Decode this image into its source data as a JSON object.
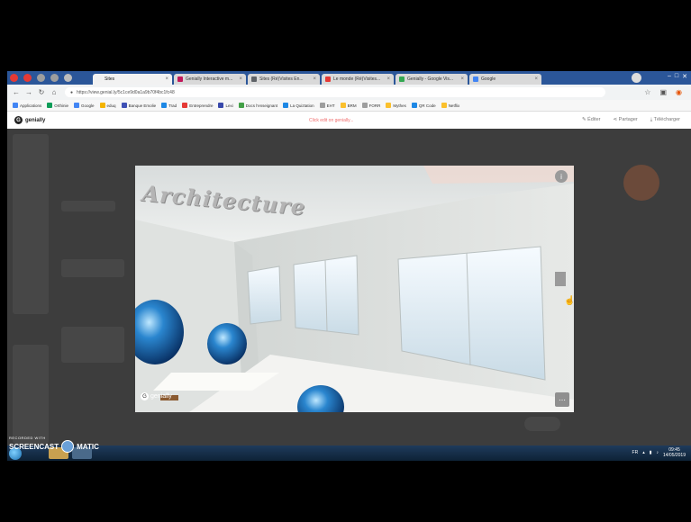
{
  "browser": {
    "tabs": [
      {
        "label": "Sites",
        "active": true,
        "color": "#f1f1f1"
      },
      {
        "label": "Genially Interactive m...",
        "active": false,
        "color": "#c2185b"
      },
      {
        "label": "Sites (Ré)Visites En...",
        "active": false,
        "color": "#5f6368"
      },
      {
        "label": "Le monde (Ré)Visites...",
        "active": false,
        "color": "#e53935"
      },
      {
        "label": "Genially - Google Vis...",
        "active": false,
        "color": "#34a853"
      },
      {
        "label": "Google",
        "active": false,
        "color": "#4285f4"
      }
    ],
    "url": "https://view.genial.ly/5c1ce9d0a1a9b70f4bc1fc48",
    "bookmarks": [
      {
        "label": "Applications",
        "color": "#4285f4"
      },
      {
        "label": "Orthinie",
        "color": "#0f9d58"
      },
      {
        "label": "Google",
        "color": "#4285f4"
      },
      {
        "label": "eduq",
        "color": "#f4b400"
      },
      {
        "label": "Banque Emolie",
        "color": "#3f51b5"
      },
      {
        "label": "Trad",
        "color": "#1e88e5"
      },
      {
        "label": "Entreprendre",
        "color": "#e53935"
      },
      {
        "label": "Lexi",
        "color": "#3949ab"
      },
      {
        "label": "Docs l'enseignant",
        "color": "#43a047"
      },
      {
        "label": "La Quiztation",
        "color": "#1e88e5"
      },
      {
        "label": "EHT",
        "color": "#9e9e9e"
      },
      {
        "label": "BRM",
        "color": "#fbc02d"
      },
      {
        "label": "FORR",
        "color": "#9e9e9e"
      },
      {
        "label": "Mythes",
        "color": "#fbc02d"
      },
      {
        "label": "QR Code",
        "color": "#1e88e5"
      },
      {
        "label": "Netflix",
        "color": "#fbc02d"
      }
    ]
  },
  "genially": {
    "logo": "genially",
    "center_text": "Click edit on genially...",
    "actions": [
      "Éditer",
      "Partager",
      "Télécharger"
    ]
  },
  "modal": {
    "title": "Architecture",
    "logo": "genially"
  },
  "watermark": {
    "line1": "RECORDED WITH",
    "line2a": "SCREENCAST",
    "line2b": "MATIC"
  },
  "taskbar": {
    "tray_lang": "FR",
    "time": "09:45",
    "date": "14/05/2019"
  }
}
